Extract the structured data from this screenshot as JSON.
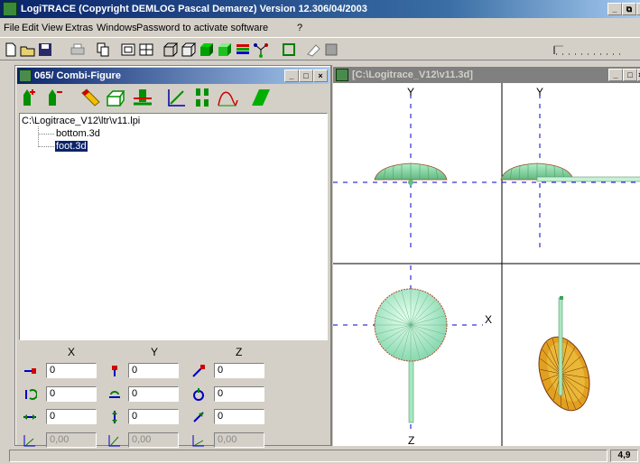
{
  "app": {
    "title": "LogiTRACE  (Copyright DEMLOG Pascal Demarez)  Version 12.306/04/2003",
    "controls": {
      "minimize": "_",
      "restore": "⧉",
      "close": "×"
    }
  },
  "menu": [
    "File",
    "Edit",
    "View",
    "Extras",
    "Windows",
    "Password to activate software",
    "?"
  ],
  "toolbar_icons": [
    "new-file-icon",
    "open-folder-icon",
    "save-icon",
    "print-icon",
    "copy-icon",
    "view-front-icon",
    "view-grid-icon",
    "wireframe-box-icon",
    "hidden-line-box-icon",
    "solid-green-icon",
    "shaded-green-icon",
    "color-bars-icon",
    "molecule-icon",
    "frame-icon",
    "eraser-icon",
    "grey-box-icon"
  ],
  "combi_window": {
    "title": "065/ Combi-Figure",
    "controls": {
      "minimize": "_",
      "restore": "□",
      "close": "×"
    },
    "tool_icons": [
      "arrow-up-plus-icon",
      "arrow-up-minus-icon",
      "pencil-eraser-icon",
      "box-edit-icon",
      "align-base-icon",
      "slant-axes-icon",
      "split-icon",
      "curve-icon",
      "parallelogram-icon"
    ],
    "tree": {
      "root": "C:\\Logitrace_V12\\ltr\\v11.lpi",
      "children": [
        "bottom.3d",
        "foot.3d"
      ]
    },
    "axes": {
      "x": "X",
      "y": "Y",
      "z": "Z"
    },
    "fields": {
      "translate": [
        "0",
        "0",
        "0"
      ],
      "rotate": [
        "0",
        "0",
        "0"
      ],
      "scale": [
        "0",
        "0",
        "0"
      ],
      "shear": [
        "0,00",
        "0,00",
        "0,00"
      ]
    }
  },
  "view_window": {
    "title": "[C:\\Logitrace_V12\\v11.3d]",
    "controls": {
      "minimize": "_",
      "restore": "□",
      "close": "×"
    },
    "axis_labels": {
      "y1": "Y",
      "y2": "Y",
      "x": "X",
      "z": "Z"
    }
  },
  "status": {
    "value": "4,9"
  },
  "colors": {
    "title_active": "#0a246a",
    "title_inactive": "#808080",
    "mesh_green": "#a8e8c0",
    "axis_blue": "#0000cc"
  }
}
